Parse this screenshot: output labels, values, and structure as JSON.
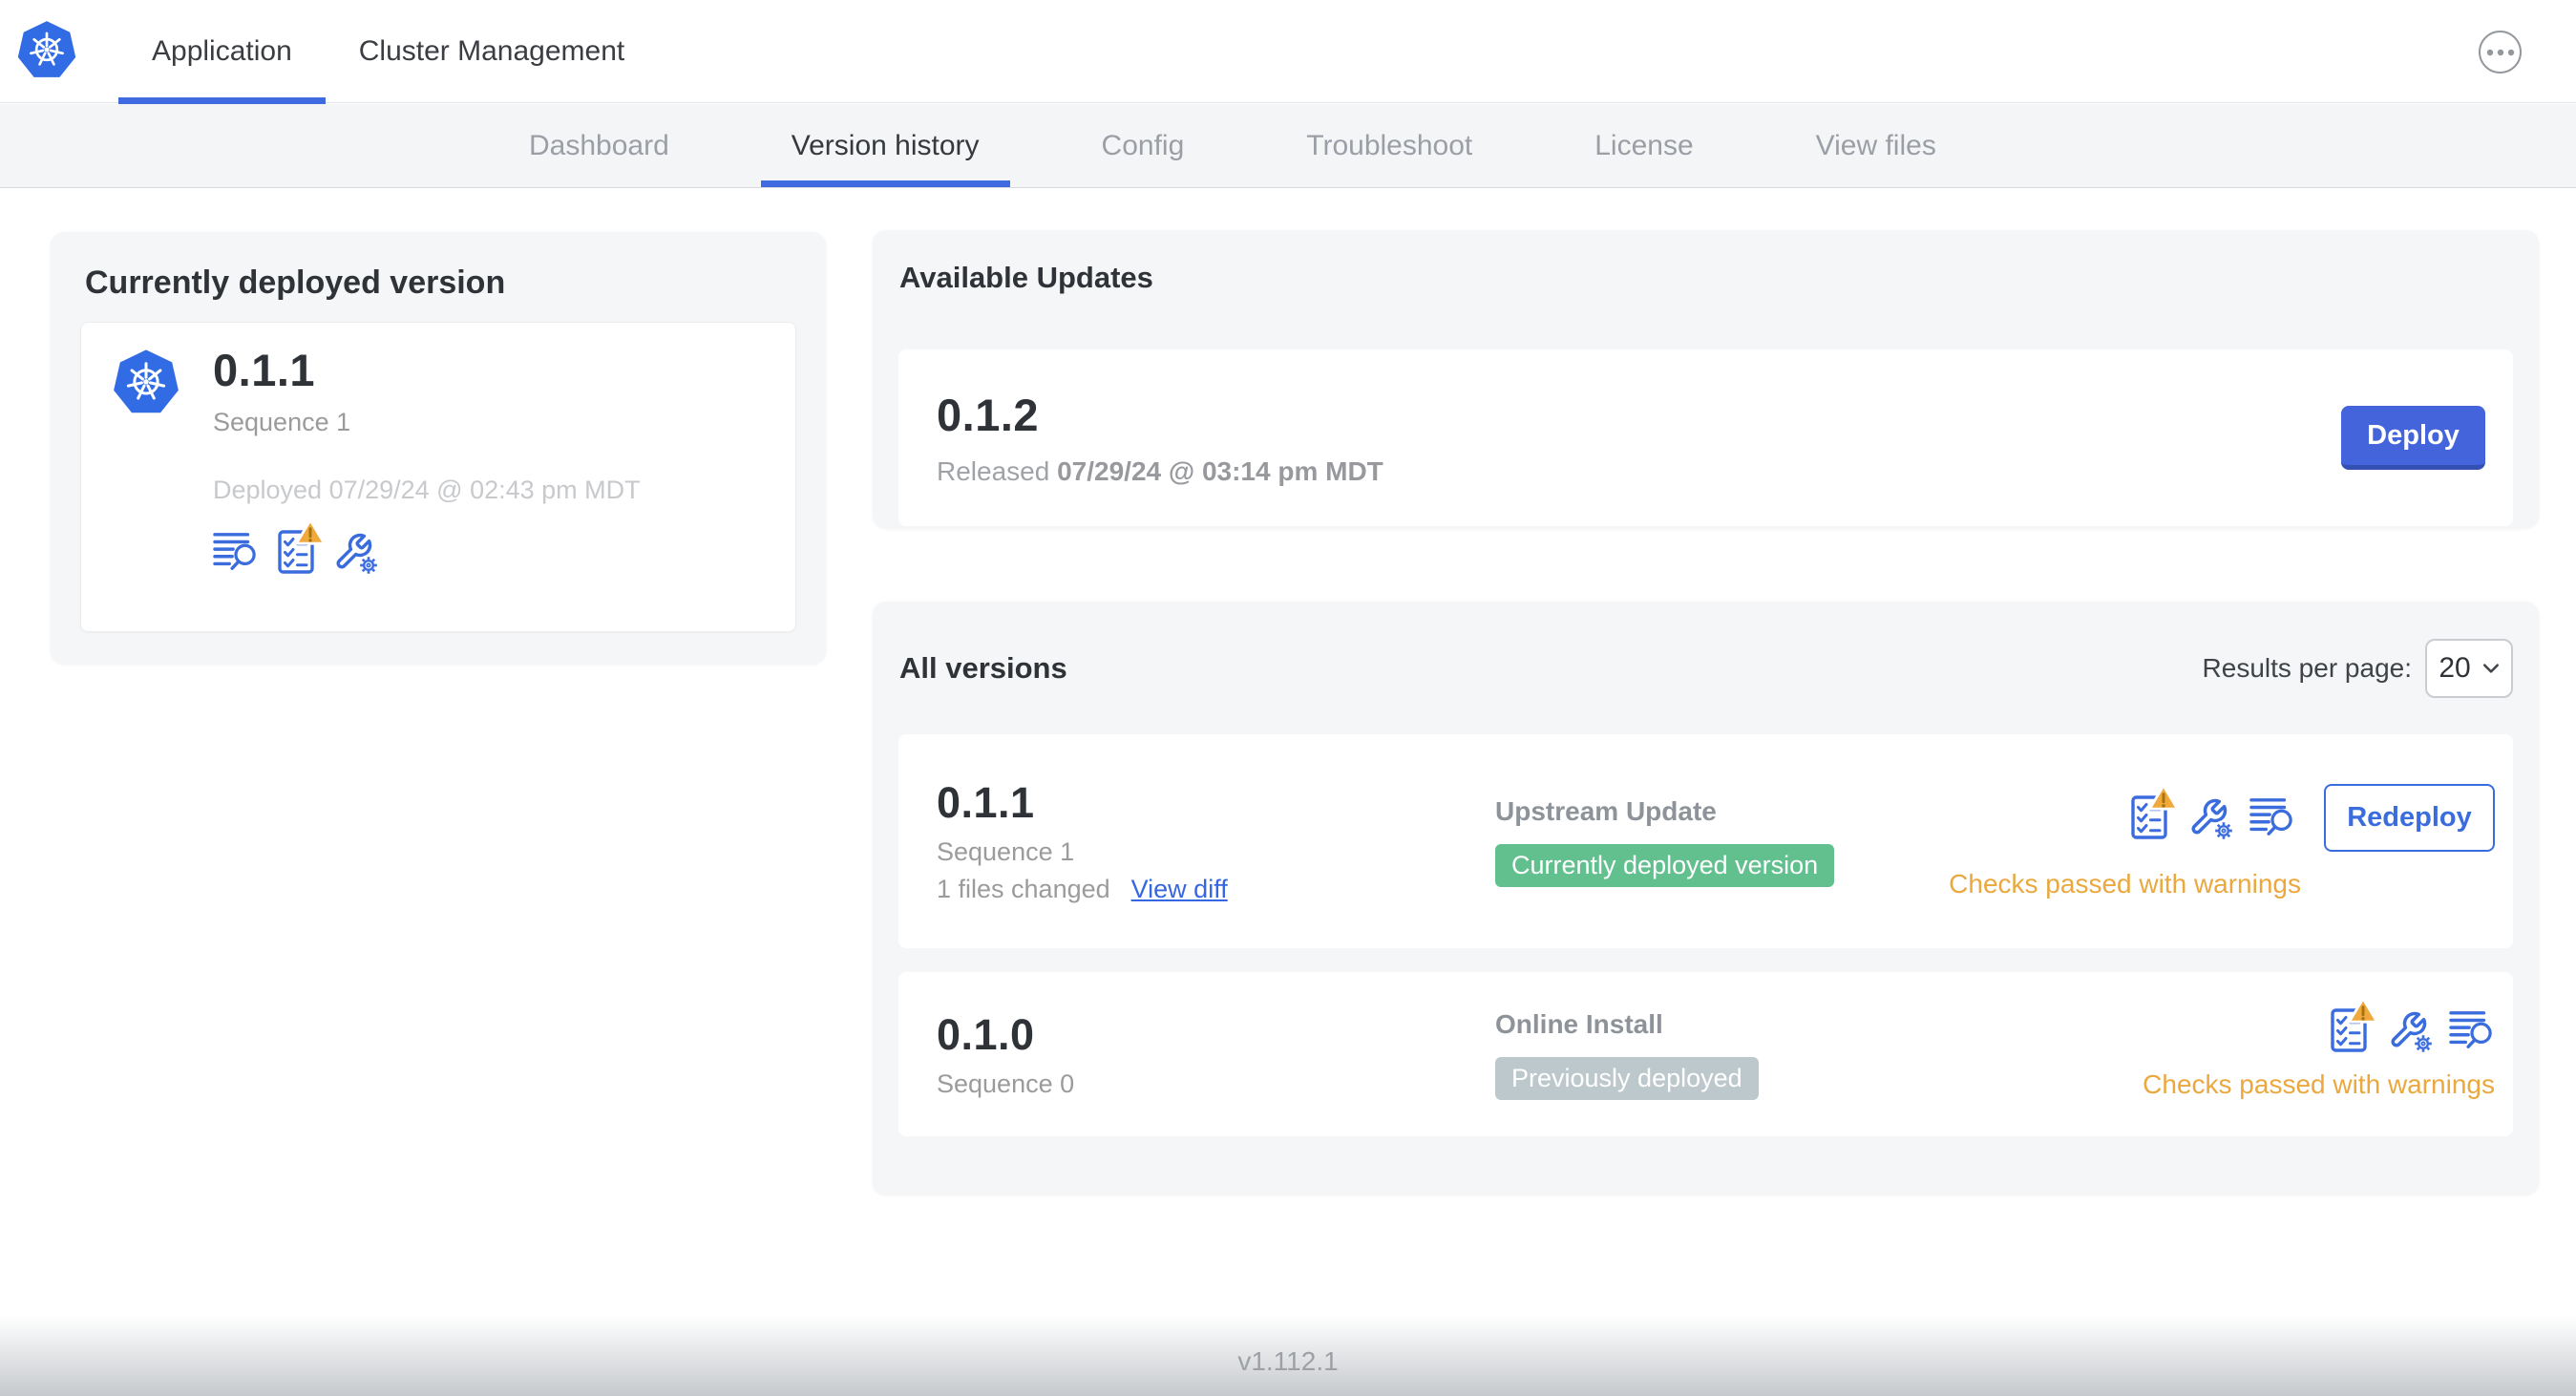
{
  "header": {
    "tabs": [
      {
        "label": "Application",
        "active": true
      },
      {
        "label": "Cluster Management",
        "active": false
      }
    ]
  },
  "subnav": {
    "tabs": [
      {
        "label": "Dashboard",
        "active": false
      },
      {
        "label": "Version history",
        "active": true
      },
      {
        "label": "Config",
        "active": false
      },
      {
        "label": "Troubleshoot",
        "active": false
      },
      {
        "label": "License",
        "active": false
      },
      {
        "label": "View files",
        "active": false
      }
    ]
  },
  "current_version": {
    "title": "Currently deployed version",
    "version": "0.1.1",
    "sequence": "Sequence 1",
    "deployed": "Deployed 07/29/24 @ 02:43 pm MDT"
  },
  "available_updates": {
    "title": "Available Updates",
    "version": "0.1.2",
    "released_prefix": "Released",
    "released_date": "07/29/24 @ 03:14 pm MDT",
    "deploy_label": "Deploy"
  },
  "all_versions": {
    "title": "All versions",
    "results_per_page_label": "Results per page:",
    "results_per_page_value": "20",
    "rows": [
      {
        "version": "0.1.1",
        "sequence": "Sequence 1",
        "files_changed": "1 files changed",
        "view_diff_label": "View diff",
        "source": "Upstream Update",
        "status_label": "Currently deployed version",
        "status_color": "#62c08f",
        "checks_label": "Checks passed with warnings",
        "action_label": "Redeploy"
      },
      {
        "version": "0.1.0",
        "sequence": "Sequence 0",
        "source": "Online Install",
        "status_label": "Previously deployed",
        "status_color": "#bdc8cc",
        "checks_label": "Checks passed with warnings"
      }
    ]
  },
  "footer": {
    "app_version": "v1.112.1"
  },
  "icons": {
    "brand": "kubernetes-logo",
    "header_more": "ellipsis-icon",
    "version_actions": [
      "deploy-logs-icon",
      "preflight-checks-icon",
      "config-icon"
    ],
    "preflight_badge": "warning-triangle-icon",
    "select_caret": "chevron-down-icon"
  },
  "colors": {
    "accent_blue": "#3b6cde",
    "button_blue": "#4464db",
    "warning_amber": "#eaa83e",
    "success_green": "#62c08f",
    "muted_gray_pill": "#bdc8cc",
    "card_bg": "#f4f6f8"
  }
}
